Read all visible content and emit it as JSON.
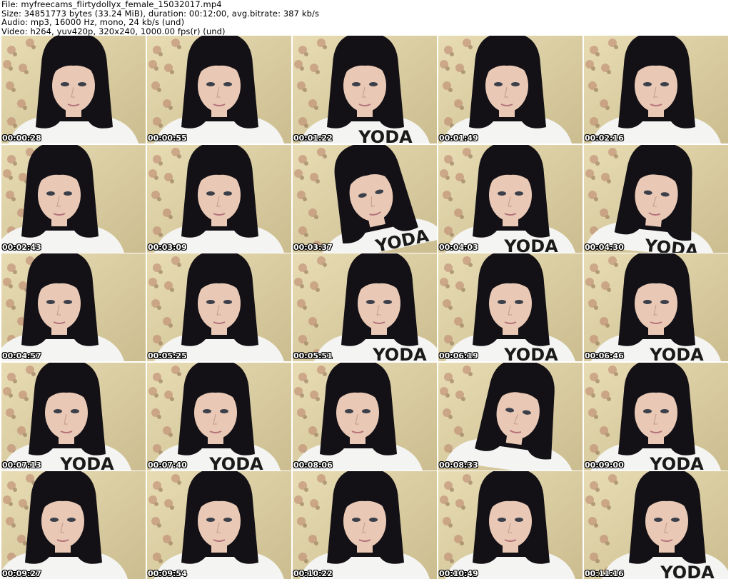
{
  "header": {
    "line1": "File: myfreecams_flirtydollyx_female_15032017.mp4",
    "line2": "Size: 34851773 bytes (33.24 MiB), duration: 00:12:00, avg.bitrate: 387 kb/s",
    "line3": "Audio: mp3, 16000 Hz, mono, 24 kb/s (und)",
    "line4": "Video: h264, yuv420p, 320x240, 1000.00 fps(r) (und)"
  },
  "thumbnails": [
    {
      "time": "00:00:28",
      "shirt_text": "",
      "head_dx": 0,
      "head_tilt": 0
    },
    {
      "time": "00:00:55",
      "shirt_text": "",
      "head_dx": 0,
      "head_tilt": 0
    },
    {
      "time": "00:01:22",
      "shirt_text": "YODA",
      "head_dx": 0,
      "head_tilt": 0
    },
    {
      "time": "00:01:49",
      "shirt_text": "",
      "head_dx": -5,
      "head_tilt": 0
    },
    {
      "time": "00:02:16",
      "shirt_text": "",
      "head_dx": 0,
      "head_tilt": 0
    },
    {
      "time": "00:02:43",
      "shirt_text": "",
      "head_dx": -20,
      "head_tilt": 0
    },
    {
      "time": "00:03:09",
      "shirt_text": "",
      "head_dx": 0,
      "head_tilt": 0
    },
    {
      "time": "00:03:37",
      "shirt_text": "YODA",
      "head_dx": 10,
      "head_tilt": -12
    },
    {
      "time": "00:04:03",
      "shirt_text": "YODA",
      "head_dx": 0,
      "head_tilt": 0
    },
    {
      "time": "00:04:30",
      "shirt_text": "YODA",
      "head_dx": 0,
      "head_tilt": 6
    },
    {
      "time": "00:04:57",
      "shirt_text": "",
      "head_dx": -20,
      "head_tilt": 0
    },
    {
      "time": "00:05:25",
      "shirt_text": "",
      "head_dx": 0,
      "head_tilt": 0
    },
    {
      "time": "00:05:51",
      "shirt_text": "YODA",
      "head_dx": 20,
      "head_tilt": 0
    },
    {
      "time": "00:06:19",
      "shirt_text": "YODA",
      "head_dx": 0,
      "head_tilt": 0
    },
    {
      "time": "00:06:46",
      "shirt_text": "YODA",
      "head_dx": 0,
      "head_tilt": 0
    },
    {
      "time": "00:07:13",
      "shirt_text": "YODA",
      "head_dx": -10,
      "head_tilt": 0
    },
    {
      "time": "00:07:40",
      "shirt_text": "YODA",
      "head_dx": -5,
      "head_tilt": 0
    },
    {
      "time": "00:08:06",
      "shirt_text": "",
      "head_dx": -10,
      "head_tilt": 0
    },
    {
      "time": "00:08:33",
      "shirt_text": "",
      "head_dx": 10,
      "head_tilt": 8
    },
    {
      "time": "00:09:00",
      "shirt_text": "YODA",
      "head_dx": 0,
      "head_tilt": 0
    },
    {
      "time": "00:09:27",
      "shirt_text": "",
      "head_dx": -15,
      "head_tilt": 0
    },
    {
      "time": "00:09:54",
      "shirt_text": "",
      "head_dx": 0,
      "head_tilt": 0
    },
    {
      "time": "00:10:22",
      "shirt_text": "",
      "head_dx": 0,
      "head_tilt": 0
    },
    {
      "time": "00:10:49",
      "shirt_text": "",
      "head_dx": 0,
      "head_tilt": 0
    },
    {
      "time": "00:11:16",
      "shirt_text": "YODA",
      "head_dx": 15,
      "head_tilt": 0
    }
  ],
  "colors": {
    "wall": "#cbbd8f",
    "wall_light": "#e8dcb4",
    "hair": "#141116",
    "skin": "#e9c9b6",
    "shirt": "#f4f4f2",
    "print": "#1a1a1a",
    "flower": "#b9806a"
  }
}
